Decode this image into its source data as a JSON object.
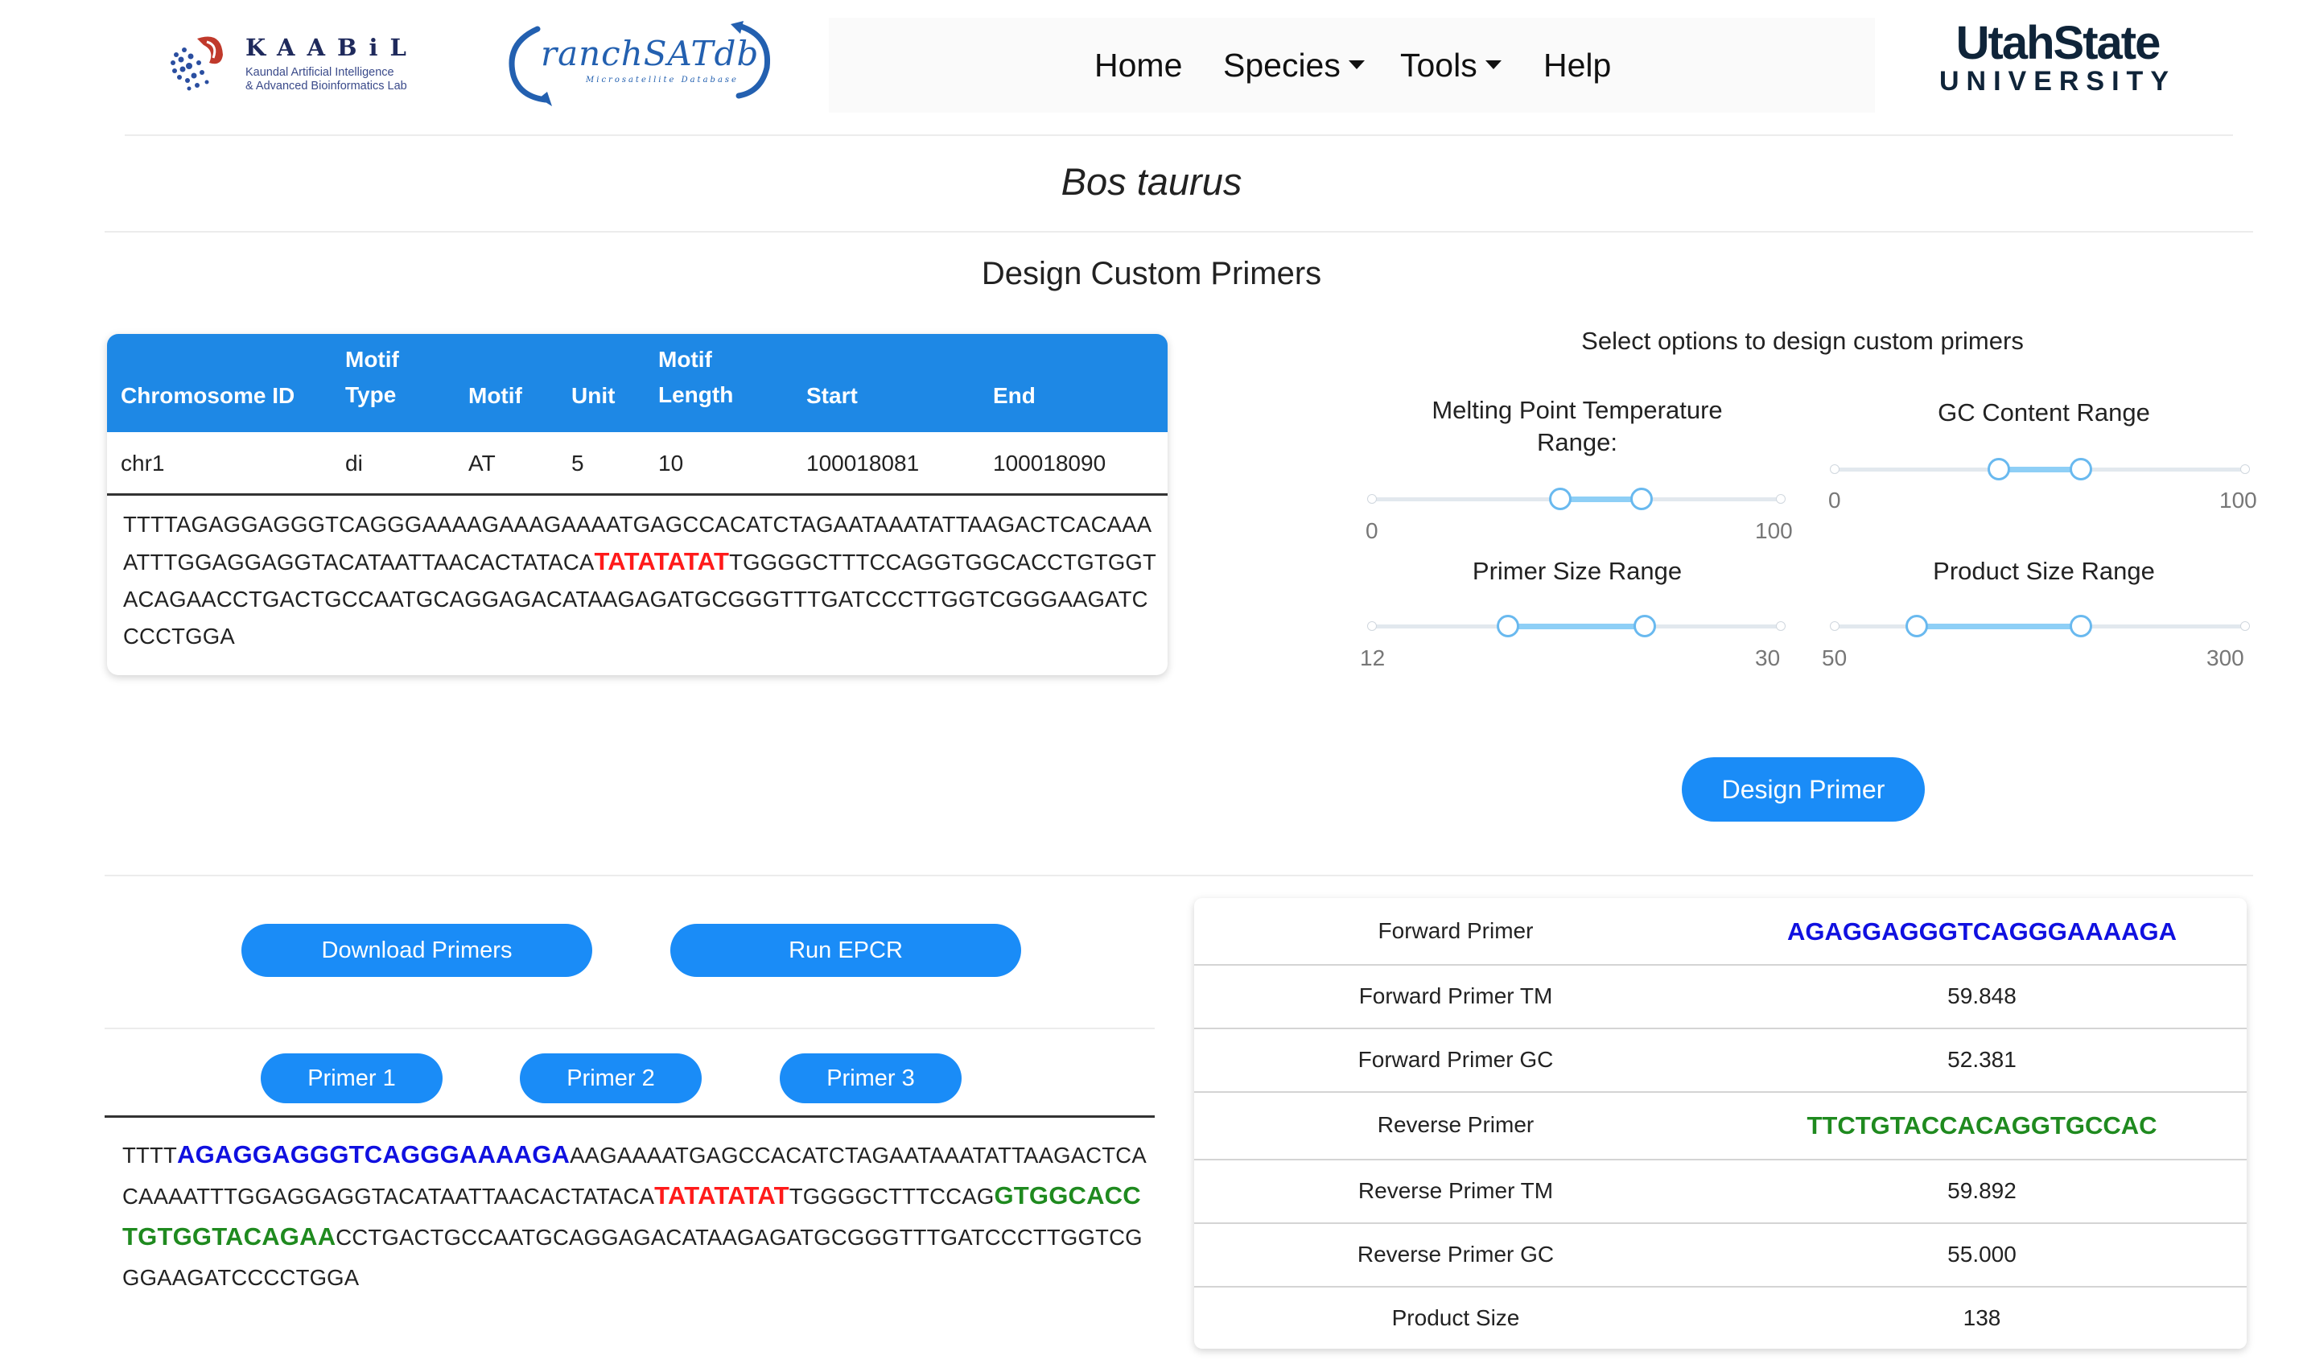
{
  "header": {
    "kaabil": {
      "name": "KAABiL",
      "sub1": "Kaundal Artificial Intelligence",
      "sub2": "& Advanced Bioinformatics Lab"
    },
    "ranch": {
      "name": "ranchSATdb",
      "sub": "Microsatellite Database"
    },
    "nav": {
      "home": "Home",
      "species": "Species",
      "tools": "Tools",
      "help": "Help"
    },
    "usu": {
      "top": "UtahState",
      "bottom": "UNIVERSITY"
    }
  },
  "species_title": "Bos taurus",
  "section_title": "Design Custom Primers",
  "ssr_table": {
    "headers": {
      "chromosome_id": "Chromosome ID",
      "motif_type_1": "Motif",
      "motif_type_2": "Type",
      "motif": "Motif",
      "unit": "Unit",
      "motif_length_1": "Motif",
      "motif_length_2": "Length",
      "start": "Start",
      "end": "End"
    },
    "row": {
      "chromosome_id": "chr1",
      "motif_type": "di",
      "motif": "AT",
      "unit": "5",
      "motif_length": "10",
      "start": "100018081",
      "end": "100018090"
    },
    "sequence": {
      "before": "TTTTAGAGGAGGGTCAGGGAAAAGAAAGAAAATGAGCCACATCTAGAATAAATATTAAGACTCACAAAATTTGGAGGAGGTACATAATTAACACTATACA",
      "motif": "TATATATAT",
      "after": "TGGGGCTTTCCAGGTGGCACCTGTGGTACAGAACCTGACTGCCAATGCAGGAGACATAAGAGATGCGGGTTTGATCCCTTGGTCGGGAAGATCCCCTGGA"
    }
  },
  "options": {
    "title": "Select options to design custom primers",
    "melting": {
      "label_1": "Melting Point Temperature",
      "label_2": "Range:",
      "min": "0",
      "max": "100",
      "low": 46,
      "high": 66
    },
    "gc": {
      "label": "GC Content Range",
      "min": "0",
      "max": "100",
      "low": 40,
      "high": 60
    },
    "primer_size": {
      "label": "Primer Size Range",
      "min": "12",
      "max": "30",
      "low": 18,
      "high": 24
    },
    "product_size": {
      "label": "Product Size Range",
      "min": "50",
      "max": "300",
      "low": 100,
      "high": 200
    },
    "design_button": "Design Primer"
  },
  "results": {
    "download_button": "Download Primers",
    "epcr_button": "Run EPCR",
    "primer_tabs": [
      "Primer 1",
      "Primer 2",
      "Primer 3"
    ],
    "sequence": {
      "s1": "TTTT",
      "fwd": "AGAGGAGGGTCAGGGAAAAGA",
      "s2": "AAGAAAATGAGCCACATCTAGAATAAATATTAAGACTCACAAAATTTGGAGGAGGTACATAATTAACACTATACA",
      "motif": "TATATATAT",
      "s3": "TGGGGCTTTCCAG",
      "rev": "GTGGCACCTGTGGTACAGAA",
      "s4": "CCTGACTGCCAATGCAGGAGACATAAGAGATGCGGGTTTGATCCCTTGGTCGGGAAGATCCCCTGGA"
    },
    "table": {
      "forward_primer_label": "Forward Primer",
      "forward_primer": "AGAGGAGGGTCAGGGAAAAGA",
      "forward_tm_label": "Forward Primer TM",
      "forward_tm": "59.848",
      "forward_gc_label": "Forward Primer GC",
      "forward_gc": "52.381",
      "reverse_primer_label": "Reverse Primer",
      "reverse_primer": "TTCTGTACCACAGGTGCCAC",
      "reverse_tm_label": "Reverse Primer TM",
      "reverse_tm": "59.892",
      "reverse_gc_label": "Reverse Primer GC",
      "reverse_gc": "55.000",
      "product_size_label": "Product Size",
      "product_size": "138"
    }
  },
  "colors": {
    "primary": "#1a8cf7",
    "table_header": "#1e88e5",
    "motif": "#ff1a1a",
    "forward": "#1010e0",
    "reverse": "#1f8a1f"
  }
}
